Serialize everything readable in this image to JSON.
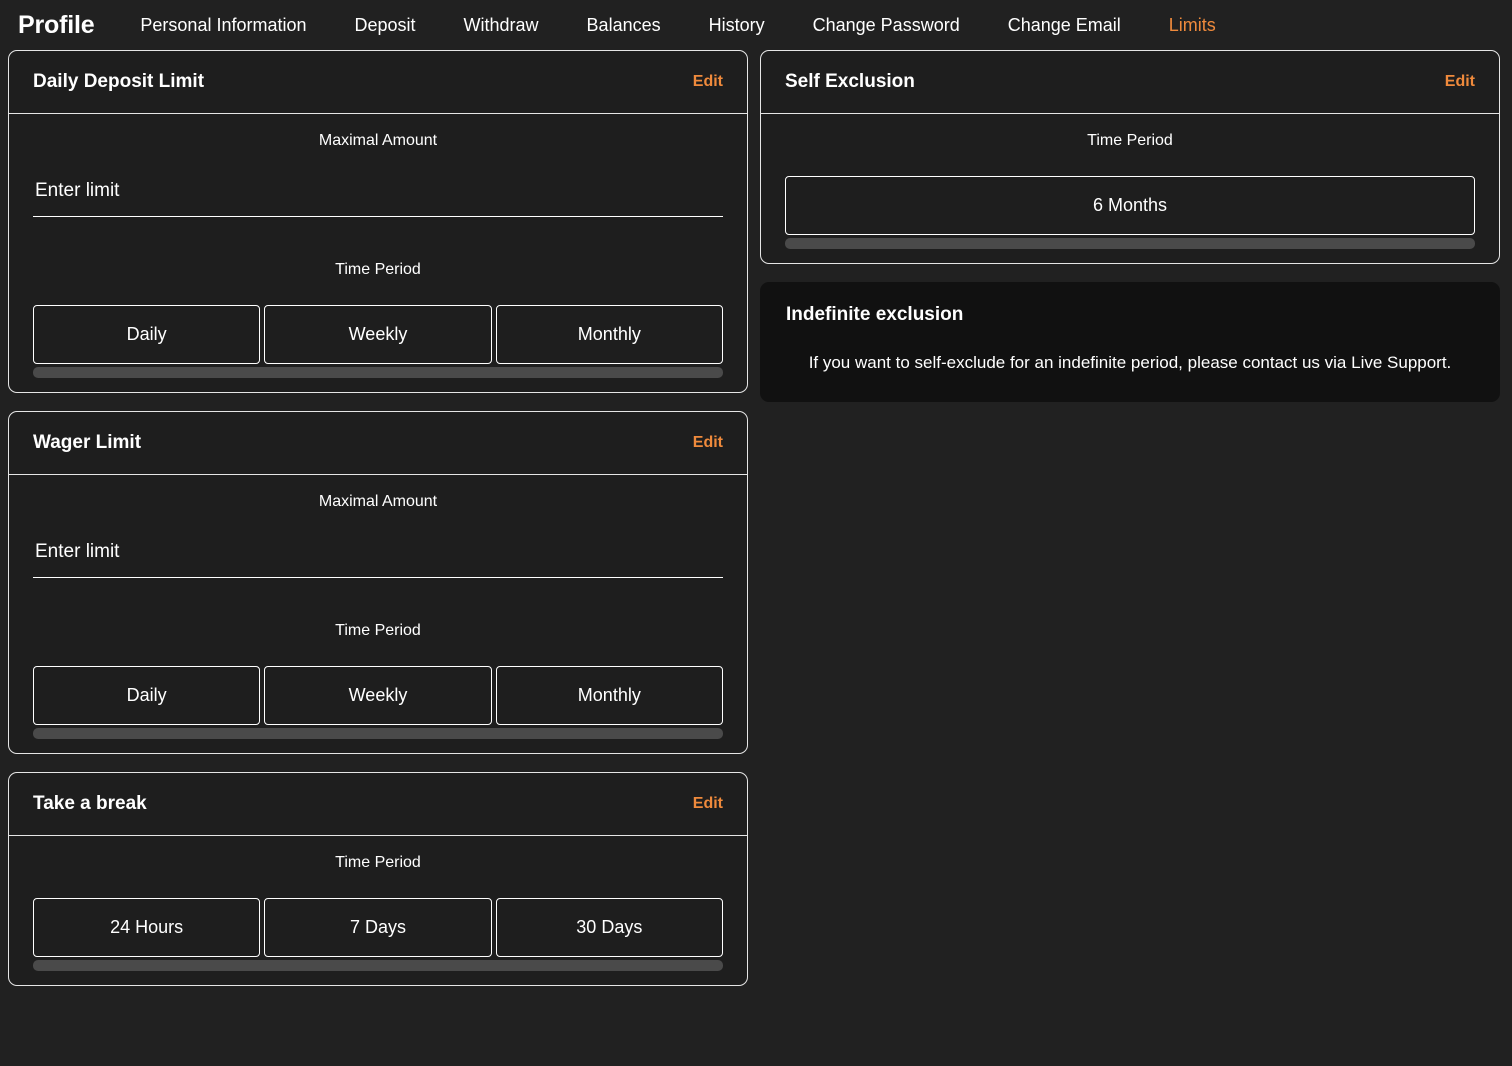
{
  "header": {
    "title": "Profile",
    "nav": [
      {
        "label": "Personal Information",
        "active": false
      },
      {
        "label": "Deposit",
        "active": false
      },
      {
        "label": "Withdraw",
        "active": false
      },
      {
        "label": "Balances",
        "active": false
      },
      {
        "label": "History",
        "active": false
      },
      {
        "label": "Change Password",
        "active": false
      },
      {
        "label": "Change Email",
        "active": false
      },
      {
        "label": "Limits",
        "active": true
      }
    ]
  },
  "colors": {
    "accent": "#ef8a3c",
    "page_background": "#212121",
    "card_background": "#1e1e1e",
    "info_card_background": "#111111",
    "border": "#e6e6e6",
    "scrollbar": "#4a4a4a",
    "text": "#ffffff"
  },
  "left_column": {
    "daily_deposit_limit": {
      "title": "Daily Deposit Limit",
      "edit_label": "Edit",
      "amount_label": "Maximal Amount",
      "amount_placeholder": "Enter limit",
      "amount_value": "",
      "period_label": "Time Period",
      "period_options": [
        "Daily",
        "Weekly",
        "Monthly"
      ]
    },
    "wager_limit": {
      "title": "Wager Limit",
      "edit_label": "Edit",
      "amount_label": "Maximal Amount",
      "amount_placeholder": "Enter limit",
      "amount_value": "",
      "period_label": "Time Period",
      "period_options": [
        "Daily",
        "Weekly",
        "Monthly"
      ]
    },
    "take_a_break": {
      "title": "Take a break",
      "edit_label": "Edit",
      "period_label": "Time Period",
      "period_options": [
        "24 Hours",
        "7 Days",
        "30 Days"
      ]
    }
  },
  "right_column": {
    "self_exclusion": {
      "title": "Self Exclusion",
      "edit_label": "Edit",
      "period_label": "Time Period",
      "period_options": [
        "6 Months"
      ]
    },
    "indefinite_exclusion": {
      "title": "Indefinite exclusion",
      "body": "If you want to self-exclude for an indefinite period, please contact us via Live Support."
    }
  }
}
